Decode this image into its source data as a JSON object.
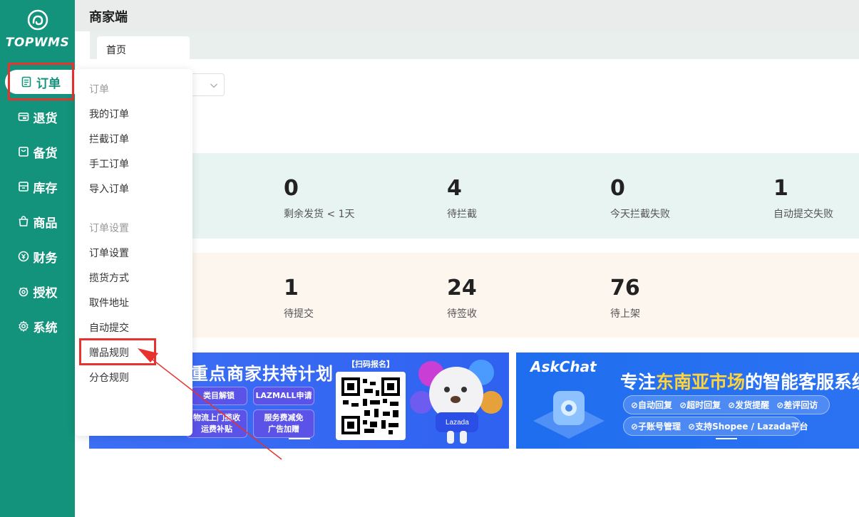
{
  "app": {
    "logo_text": "TOPWMS",
    "page_title": "商家端"
  },
  "sidebar": {
    "items": [
      {
        "label": "订单",
        "icon": "order-icon"
      },
      {
        "label": "退货",
        "icon": "return-icon"
      },
      {
        "label": "备货",
        "icon": "stock-prep-icon"
      },
      {
        "label": "库存",
        "icon": "inventory-icon"
      },
      {
        "label": "商品",
        "icon": "product-icon"
      },
      {
        "label": "财务",
        "icon": "finance-icon"
      },
      {
        "label": "授权",
        "icon": "auth-icon"
      },
      {
        "label": "系统",
        "icon": "gear-icon"
      }
    ]
  },
  "tabs": [
    {
      "label": "首页"
    }
  ],
  "stats_row1": [
    {
      "value": "0",
      "label": "剩余发货 < 1天"
    },
    {
      "value": "4",
      "label": "待拦截"
    },
    {
      "value": "0",
      "label": "今天拦截失败"
    },
    {
      "value": "1",
      "label": "自动提交失败"
    }
  ],
  "stats_row2": [
    {
      "value": "1",
      "label": "待提交"
    },
    {
      "value": "24",
      "label": "待签收"
    },
    {
      "value": "76",
      "label": "待上架"
    }
  ],
  "dropdown": {
    "group1": "订单",
    "group1_items": [
      "我的订单",
      "拦截订单",
      "手工订单",
      "导入订单"
    ],
    "group2": "订单设置",
    "group2_items": [
      "订单设置",
      "揽货方式",
      "取件地址",
      "自动提交",
      "赠品规则",
      "分仓规则"
    ]
  },
  "banner1": {
    "headline": "重点商家扶持计划",
    "pills": [
      "类目解锁",
      "LAZMALL申请",
      "物流上门揽收\n运费补贴",
      "服务费减免\n广告加赠"
    ],
    "qr_title": "【扫码报名】",
    "mascot_label": "Lazada"
  },
  "banner2": {
    "brand": "AskChat",
    "headline_prefix": "专注",
    "headline_highlight": "东南亚市场",
    "headline_suffix": "的智能客服系统",
    "chips_row1": [
      "⊘自动回复",
      "⊘超时回复",
      "⊘发货提醒",
      "⊘差评回访"
    ],
    "chips_row2": [
      "⊘子账号管理",
      "⊘支持Shopee / Lazada平台"
    ]
  },
  "colors": {
    "sidebar": "#13937b",
    "accent_red": "#e8322f",
    "green_card": "#e8f4f1",
    "peach_card": "#fdf6ef"
  }
}
